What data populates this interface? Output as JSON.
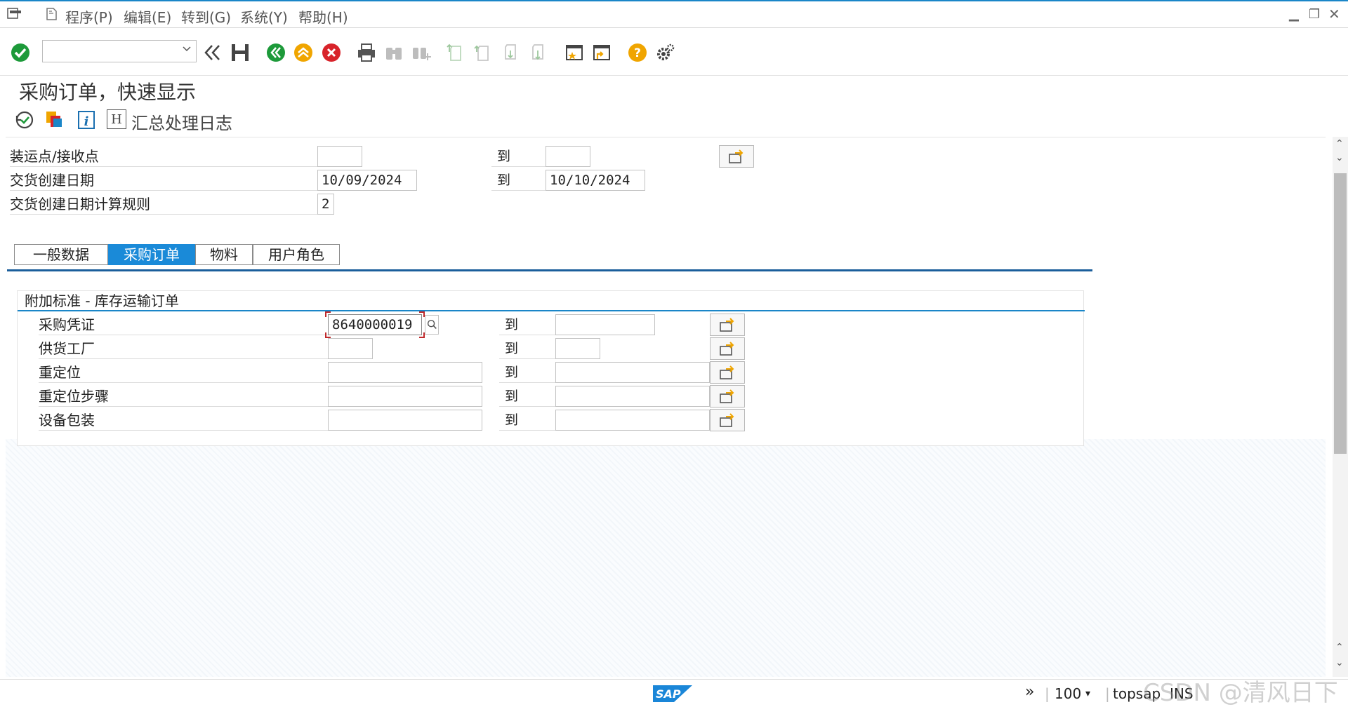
{
  "menu": {
    "items": [
      "程序(P)",
      "编辑(E)",
      "转到(G)",
      "系统(Y)",
      "帮助(H)"
    ]
  },
  "page_title": "采购订单，快速显示",
  "app_toolbar": {
    "label": "汇总处理日志",
    "h_button": "H"
  },
  "header_fields": [
    {
      "label": "装运点/接收点",
      "from": "",
      "to_label": "到",
      "to": ""
    },
    {
      "label": "交货创建日期",
      "from": "10/09/2024",
      "to_label": "到",
      "to": "10/10/2024"
    },
    {
      "label": "交货创建日期计算规则",
      "from": "2"
    }
  ],
  "tabs": [
    "一般数据",
    "采购订单",
    "物料",
    "用户角色"
  ],
  "active_tab": "采购订单",
  "group": {
    "title": "附加标准 - 库存运输订单",
    "rows": [
      {
        "label": "采购凭证",
        "from": "8640000019",
        "to_label": "到",
        "to": ""
      },
      {
        "label": "供货工厂",
        "from": "",
        "to_label": "到",
        "to": ""
      },
      {
        "label": "重定位",
        "from": "",
        "to_label": "到",
        "to": ""
      },
      {
        "label": "重定位步骤",
        "from": "",
        "to_label": "到",
        "to": ""
      },
      {
        "label": "设备包装",
        "from": "",
        "to_label": "到",
        "to": ""
      }
    ]
  },
  "status": {
    "zoom": "100",
    "user": "topsap",
    "mode": "INS",
    "logo": "SAP"
  },
  "watermark": "CSDN @清风日下",
  "colors": {
    "accent": "#1a86c8",
    "active_tab": "#1a8ad8",
    "ok_green": "#1d9a3a",
    "cancel_red": "#d8232a",
    "exit_orange": "#f0a500"
  }
}
